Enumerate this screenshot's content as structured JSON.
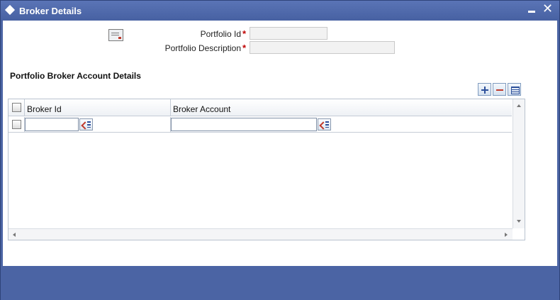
{
  "window": {
    "title": "Broker Details",
    "minimize_icon": "minimize-icon",
    "close_icon": "close-icon",
    "close_glyph": "✕"
  },
  "form": {
    "portfolio_id_label": "Portfolio Id",
    "portfolio_id_value": "",
    "portfolio_description_label": "Portfolio Description",
    "portfolio_description_value": "",
    "required_marker": "*"
  },
  "section": {
    "title": "Portfolio Broker Account Details",
    "toolbar_icons": [
      "add-row-icon",
      "delete-row-icon",
      "single-view-icon"
    ]
  },
  "grid": {
    "columns": [
      "Broker Id",
      "Broker Account"
    ],
    "rows": [
      {
        "broker_id": "",
        "broker_account": ""
      }
    ]
  },
  "colors": {
    "title_bar": "#4b64a4",
    "content_bg": "#ffffff",
    "required": "#c00000"
  }
}
